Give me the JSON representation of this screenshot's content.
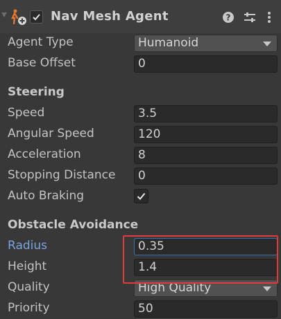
{
  "component": {
    "title": "Nav Mesh Agent",
    "enabled": true
  },
  "fields_top": [
    {
      "label": "Agent Type",
      "type": "dropdown",
      "value": "Humanoid"
    },
    {
      "label": "Base Offset",
      "type": "number",
      "value": "0"
    }
  ],
  "steering": {
    "heading": "Steering",
    "fields": [
      {
        "label": "Speed",
        "value": "3.5"
      },
      {
        "label": "Angular Speed",
        "value": "120"
      },
      {
        "label": "Acceleration",
        "value": "8"
      },
      {
        "label": "Stopping Distance",
        "value": "0"
      },
      {
        "label": "Auto Braking",
        "checked": true
      }
    ]
  },
  "obstacle": {
    "heading": "Obstacle Avoidance",
    "radius": {
      "label": "Radius",
      "value": "0.35"
    },
    "height": {
      "label": "Height",
      "value": "1.4"
    },
    "quality": {
      "label": "Quality",
      "value": "High Quality"
    },
    "priority": {
      "label": "Priority",
      "value": "50"
    }
  },
  "colors": {
    "panel_bg": "#383838",
    "header_bg": "#3e3e3e",
    "active_label": "#7aa4e0",
    "highlight_border": "#e03a3a"
  }
}
